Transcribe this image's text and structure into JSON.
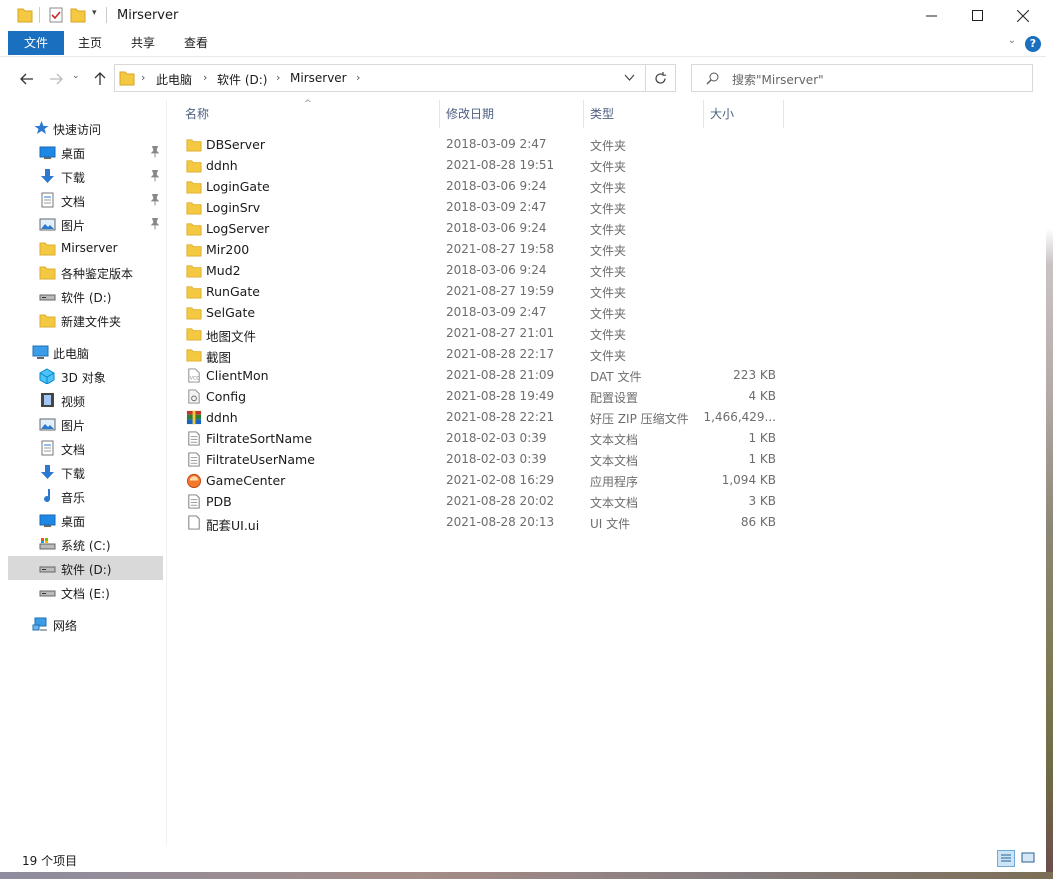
{
  "window": {
    "title": "Mirserver"
  },
  "ribbon": {
    "tabs": [
      "文件",
      "主页",
      "共享",
      "查看"
    ],
    "help": "?"
  },
  "address": {
    "crumbs": [
      "此电脑",
      "软件 (D:)",
      "Mirserver"
    ]
  },
  "search": {
    "placeholder": "搜索\"Mirserver\""
  },
  "sidebar": {
    "quick_access": "快速访问",
    "quick_items": [
      {
        "label": "桌面",
        "icon": "desktop-icon",
        "pinned": true
      },
      {
        "label": "下载",
        "icon": "download-icon",
        "pinned": true
      },
      {
        "label": "文档",
        "icon": "document-icon",
        "pinned": true
      },
      {
        "label": "图片",
        "icon": "picture-icon",
        "pinned": true
      },
      {
        "label": "Mirserver",
        "icon": "folder-icon",
        "pinned": false
      },
      {
        "label": "各种鉴定版本",
        "icon": "folder-icon",
        "pinned": false
      },
      {
        "label": "软件 (D:)",
        "icon": "drive-icon",
        "pinned": false
      },
      {
        "label": "新建文件夹",
        "icon": "folder-icon",
        "pinned": false
      }
    ],
    "this_pc": "此电脑",
    "pc_items": [
      {
        "label": "3D 对象",
        "icon": "3d-objects-icon"
      },
      {
        "label": "视频",
        "icon": "video-icon"
      },
      {
        "label": "图片",
        "icon": "picture-icon"
      },
      {
        "label": "文档",
        "icon": "document-icon"
      },
      {
        "label": "下载",
        "icon": "download-icon"
      },
      {
        "label": "音乐",
        "icon": "music-icon"
      },
      {
        "label": "桌面",
        "icon": "desktop-icon"
      },
      {
        "label": "系统 (C:)",
        "icon": "system-drive-icon"
      },
      {
        "label": "软件 (D:)",
        "icon": "drive-icon"
      },
      {
        "label": "文档 (E:)",
        "icon": "drive-icon"
      }
    ],
    "network": "网络"
  },
  "columns": {
    "name": "名称",
    "date": "修改日期",
    "type": "类型",
    "size": "大小"
  },
  "files": [
    {
      "name": "DBServer",
      "date": "2018-03-09 2:47",
      "type": "文件夹",
      "size": "",
      "icon": "folder-icon"
    },
    {
      "name": "ddnh",
      "date": "2021-08-28 19:51",
      "type": "文件夹",
      "size": "",
      "icon": "folder-icon"
    },
    {
      "name": "LoginGate",
      "date": "2018-03-06 9:24",
      "type": "文件夹",
      "size": "",
      "icon": "folder-icon"
    },
    {
      "name": "LoginSrv",
      "date": "2018-03-09 2:47",
      "type": "文件夹",
      "size": "",
      "icon": "folder-icon"
    },
    {
      "name": "LogServer",
      "date": "2018-03-06 9:24",
      "type": "文件夹",
      "size": "",
      "icon": "folder-icon"
    },
    {
      "name": "Mir200",
      "date": "2021-08-27 19:58",
      "type": "文件夹",
      "size": "",
      "icon": "folder-icon"
    },
    {
      "name": "Mud2",
      "date": "2018-03-06 9:24",
      "type": "文件夹",
      "size": "",
      "icon": "folder-icon"
    },
    {
      "name": "RunGate",
      "date": "2021-08-27 19:59",
      "type": "文件夹",
      "size": "",
      "icon": "folder-icon"
    },
    {
      "name": "SelGate",
      "date": "2018-03-09 2:47",
      "type": "文件夹",
      "size": "",
      "icon": "folder-icon"
    },
    {
      "name": "地图文件",
      "date": "2021-08-27 21:01",
      "type": "文件夹",
      "size": "",
      "icon": "folder-icon"
    },
    {
      "name": "截图",
      "date": "2021-08-28 22:17",
      "type": "文件夹",
      "size": "",
      "icon": "folder-icon"
    },
    {
      "name": "ClientMon",
      "date": "2021-08-28 21:09",
      "type": "DAT 文件",
      "size": "223 KB",
      "icon": "dat-file-icon"
    },
    {
      "name": "Config",
      "date": "2021-08-28 19:49",
      "type": "配置设置",
      "size": "4 KB",
      "icon": "config-file-icon"
    },
    {
      "name": "ddnh",
      "date": "2021-08-28 22:21",
      "type": "好压 ZIP 压缩文件",
      "size": "1,466,429...",
      "icon": "zip-archive-icon"
    },
    {
      "name": "FiltrateSortName",
      "date": "2018-02-03 0:39",
      "type": "文本文档",
      "size": "1 KB",
      "icon": "text-file-icon"
    },
    {
      "name": "FiltrateUserName",
      "date": "2018-02-03 0:39",
      "type": "文本文档",
      "size": "1 KB",
      "icon": "text-file-icon"
    },
    {
      "name": "GameCenter",
      "date": "2021-02-08 16:29",
      "type": "应用程序",
      "size": "1,094 KB",
      "icon": "application-icon"
    },
    {
      "name": "PDB",
      "date": "2021-08-28 20:02",
      "type": "文本文档",
      "size": "3 KB",
      "icon": "text-file-icon"
    },
    {
      "name": "配套UI.ui",
      "date": "2021-08-28 20:13",
      "type": "UI 文件",
      "size": "86 KB",
      "icon": "blank-file-icon"
    }
  ],
  "status": {
    "count": "19 个项目"
  },
  "colors": {
    "accent": "#1a6fbf",
    "folder": "#f5c842",
    "selected": "#d9d9d9"
  }
}
